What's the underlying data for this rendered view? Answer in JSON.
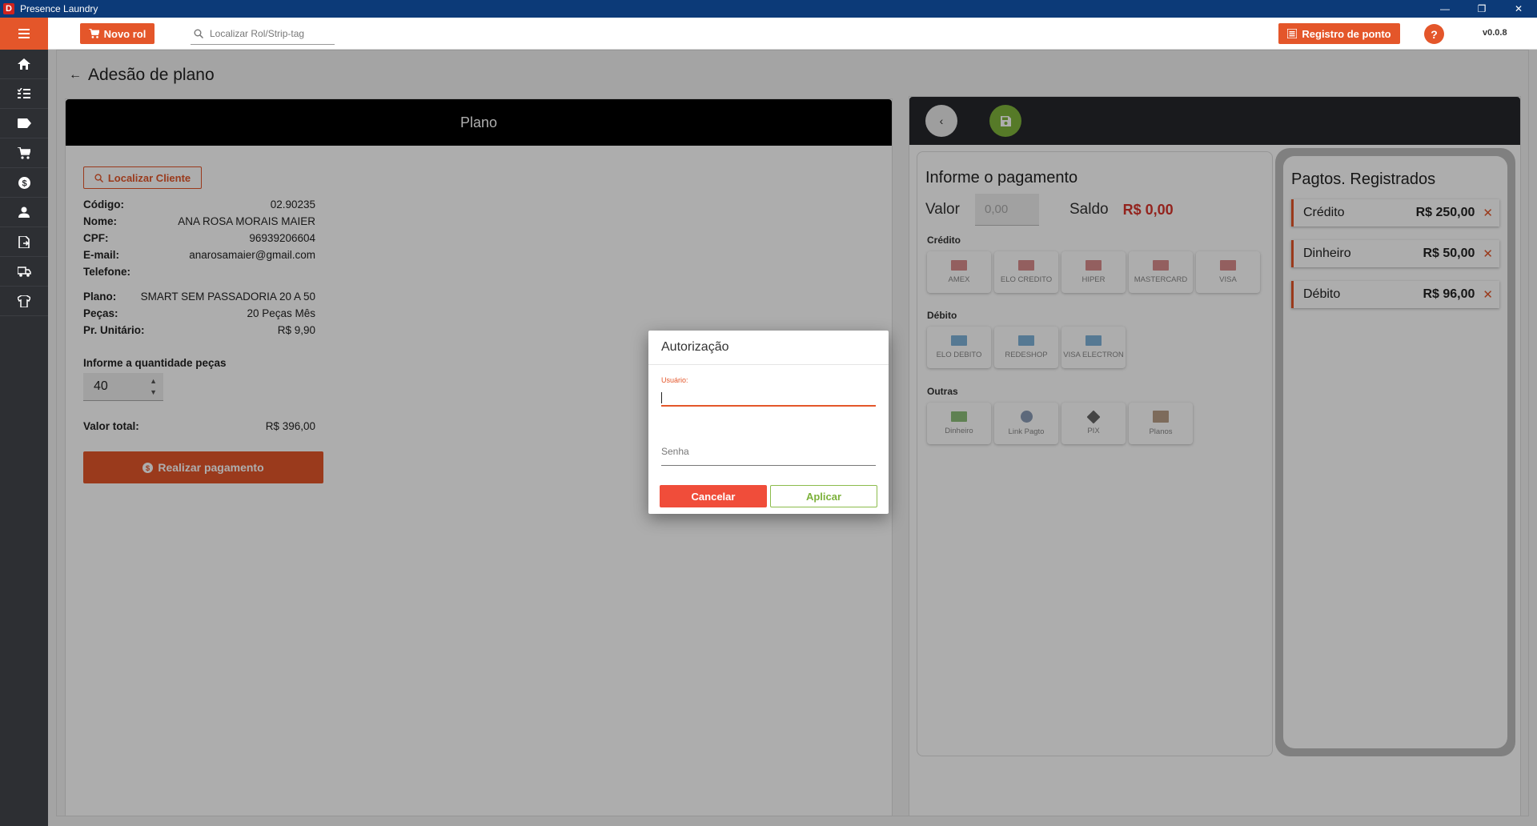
{
  "window": {
    "title": "Presence Laundry",
    "logo": "D"
  },
  "topbar": {
    "novo_rol": "Novo rol",
    "search_placeholder": "Localizar Rol/Strip-tag",
    "registro": "Registro de ponto",
    "help": "?",
    "version": "v0.0.8"
  },
  "sidebar": {
    "items": [
      "home-icon",
      "checklist-icon",
      "tag-icon",
      "cart-icon",
      "dollar-icon",
      "person-icon",
      "document-icon",
      "truck-icon",
      "shirt-icon"
    ]
  },
  "page": {
    "title": "Adesão de plano"
  },
  "plano": {
    "header": "Plano",
    "localizar": "Localizar Cliente",
    "client": [
      {
        "label": "Código:",
        "value": "02.90235"
      },
      {
        "label": "Nome:",
        "value": "ANA ROSA MORAIS MAIER"
      },
      {
        "label": "CPF:",
        "value": "96939206604"
      },
      {
        "label": "E-mail:",
        "value": "anarosamaier@gmail.com"
      },
      {
        "label": "Telefone:",
        "value": ""
      }
    ],
    "plan": [
      {
        "label": "Plano:",
        "value": "SMART SEM PASSADORIA 20 A 50"
      },
      {
        "label": "Peças:",
        "value": "20 Peças Mês"
      },
      {
        "label": "Pr. Unitário:",
        "value": "R$ 9,90"
      }
    ],
    "qty_label": "Informe a quantidade peças",
    "qty_value": "40",
    "total_label": "Valor total:",
    "total_value": "R$ 396,00",
    "pay_button": "Realizar pagamento"
  },
  "payment": {
    "title": "Informe o pagamento",
    "valor_label": "Valor",
    "valor_placeholder": "0,00",
    "saldo_label": "Saldo",
    "saldo_value": "R$ 0,00",
    "credito_title": "Crédito",
    "credito": [
      "AMEX",
      "ELO CREDITO",
      "HIPER",
      "MASTERCARD",
      "VISA"
    ],
    "debito_title": "Débito",
    "debito": [
      "ELO DEBITO",
      "REDESHOP",
      "VISA ELECTRON"
    ],
    "outras_title": "Outras",
    "outras": [
      "Dinheiro",
      "Link Pagto",
      "PIX",
      "Planos"
    ]
  },
  "registered": {
    "title": "Pagtos. Registrados",
    "items": [
      {
        "name": "Crédito",
        "amount": "R$ 250,00"
      },
      {
        "name": "Dinheiro",
        "amount": "R$ 50,00"
      },
      {
        "name": "Débito",
        "amount": "R$ 96,00"
      }
    ]
  },
  "dialog": {
    "title": "Autorização",
    "user_label": "Usuário:",
    "user_value": "",
    "password_placeholder": "Senha",
    "cancel": "Cancelar",
    "apply": "Aplicar"
  },
  "colors": {
    "accent": "#e4562a",
    "titlebar": "#0c3a78",
    "sidebar": "#2d2f33",
    "success": "#7fb43c",
    "danger": "#d9342b"
  }
}
